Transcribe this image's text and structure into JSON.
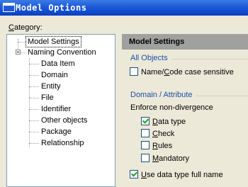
{
  "window": {
    "title": "Model Options"
  },
  "category": {
    "label_u": "C",
    "label_rest": "ategory:",
    "tree": [
      {
        "label": "Model Settings",
        "level": 0
      },
      {
        "label": "Naming Convention",
        "level": 0
      },
      {
        "label": "Data Item",
        "level": 1
      },
      {
        "label": "Domain",
        "level": 1
      },
      {
        "label": "Entity",
        "level": 1
      },
      {
        "label": "File",
        "level": 1
      },
      {
        "label": "Identifier",
        "level": 1
      },
      {
        "label": "Other objects",
        "level": 1
      },
      {
        "label": "Package",
        "level": 1
      },
      {
        "label": "Relationship",
        "level": 1
      }
    ]
  },
  "panel": {
    "header": "Model Settings",
    "all_objects": {
      "title": "All Objects",
      "name_code_pre": "Name/",
      "name_code_u": "C",
      "name_code_post": "ode case sensitive",
      "name_code_checked": false
    },
    "domain_attribute": {
      "title": "Domain / Attribute",
      "enforce_label": "Enforce non-divergence",
      "data_type": {
        "u": "D",
        "rest": "ata type",
        "checked": true
      },
      "check": {
        "u": "C",
        "rest": "heck",
        "checked": false
      },
      "rules": {
        "u": "R",
        "rest": "ules",
        "checked": false
      },
      "mandatory": {
        "u": "M",
        "rest": "andatory",
        "checked": false
      },
      "full_name": {
        "u": "U",
        "rest": "se data type full name",
        "checked": true
      }
    }
  }
}
